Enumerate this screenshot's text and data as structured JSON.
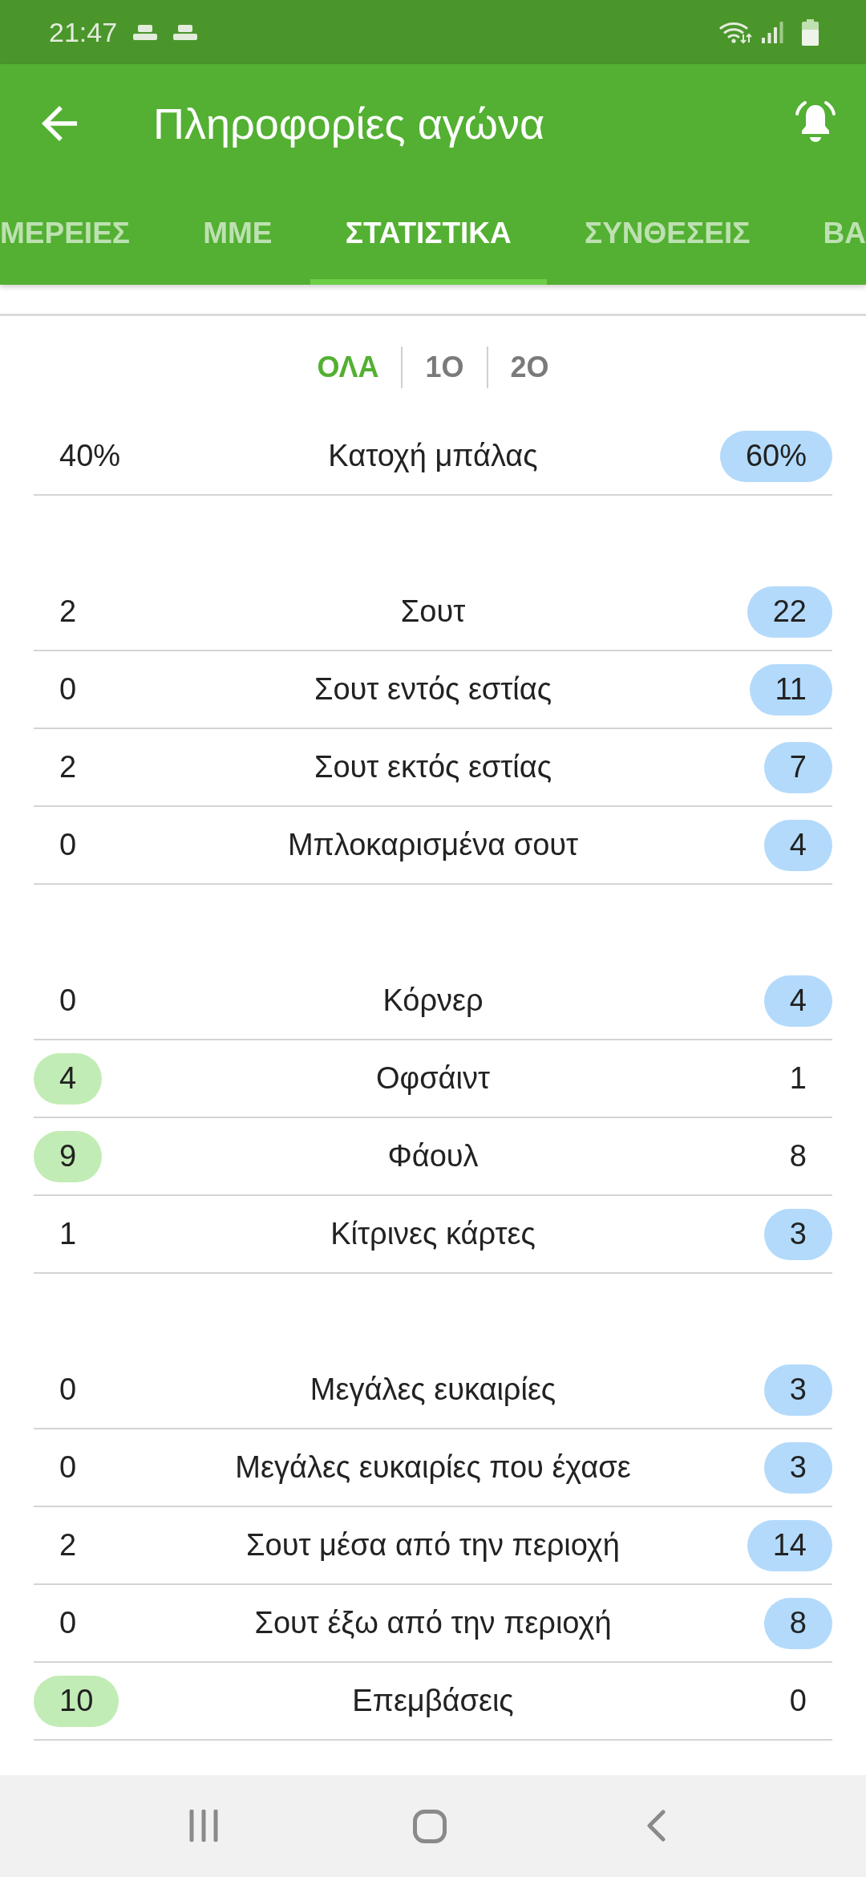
{
  "status_bar": {
    "time": "21:47"
  },
  "app_bar": {
    "title": "Πληροφορίες αγώνα"
  },
  "tabs": [
    {
      "label": "ΜΕΡΕΙΕΣ",
      "selected": false
    },
    {
      "label": "ΜΜΕ",
      "selected": false
    },
    {
      "label": "ΣΤΑΤΙΣΤΙΚΑ",
      "selected": true
    },
    {
      "label": "ΣΥΝΘΕΣΕΙΣ",
      "selected": false
    },
    {
      "label": "ΒΑ",
      "selected": false
    }
  ],
  "periods": [
    {
      "label": "ΟΛΑ",
      "selected": true
    },
    {
      "label": "1Ο",
      "selected": false
    },
    {
      "label": "2Ο",
      "selected": false
    }
  ],
  "stat_groups": [
    {
      "rows": [
        {
          "label": "Κατοχή μπάλας",
          "home": {
            "value": "40%",
            "highlighted": false
          },
          "away": {
            "value": "60%",
            "highlighted": true
          }
        }
      ]
    },
    {
      "rows": [
        {
          "label": "Σουτ",
          "home": {
            "value": "2",
            "highlighted": false
          },
          "away": {
            "value": "22",
            "highlighted": true
          }
        },
        {
          "label": "Σουτ εντός εστίας",
          "home": {
            "value": "0",
            "highlighted": false
          },
          "away": {
            "value": "11",
            "highlighted": true
          }
        },
        {
          "label": "Σουτ εκτός εστίας",
          "home": {
            "value": "2",
            "highlighted": false
          },
          "away": {
            "value": "7",
            "highlighted": true
          }
        },
        {
          "label": "Μπλοκαρισμένα σουτ",
          "home": {
            "value": "0",
            "highlighted": false
          },
          "away": {
            "value": "4",
            "highlighted": true
          }
        }
      ]
    },
    {
      "rows": [
        {
          "label": "Κόρνερ",
          "home": {
            "value": "0",
            "highlighted": false
          },
          "away": {
            "value": "4",
            "highlighted": true
          }
        },
        {
          "label": "Οφσάιντ",
          "home": {
            "value": "4",
            "highlighted": true
          },
          "away": {
            "value": "1",
            "highlighted": false
          }
        },
        {
          "label": "Φάουλ",
          "home": {
            "value": "9",
            "highlighted": true
          },
          "away": {
            "value": "8",
            "highlighted": false
          }
        },
        {
          "label": "Κίτρινες κάρτες",
          "home": {
            "value": "1",
            "highlighted": false
          },
          "away": {
            "value": "3",
            "highlighted": true
          }
        }
      ]
    },
    {
      "rows": [
        {
          "label": "Μεγάλες ευκαιρίες",
          "home": {
            "value": "0",
            "highlighted": false
          },
          "away": {
            "value": "3",
            "highlighted": true
          }
        },
        {
          "label": "Μεγάλες ευκαιρίες που έχασε",
          "home": {
            "value": "0",
            "highlighted": false
          },
          "away": {
            "value": "3",
            "highlighted": true
          }
        },
        {
          "label": "Σουτ μέσα από την περιοχή",
          "home": {
            "value": "2",
            "highlighted": false
          },
          "away": {
            "value": "14",
            "highlighted": true
          }
        },
        {
          "label": "Σουτ έξω από την περιοχή",
          "home": {
            "value": "0",
            "highlighted": false
          },
          "away": {
            "value": "8",
            "highlighted": true
          }
        },
        {
          "label": "Επεμβάσεις",
          "home": {
            "value": "10",
            "highlighted": true
          },
          "away": {
            "value": "0",
            "highlighted": false
          }
        }
      ]
    }
  ]
}
